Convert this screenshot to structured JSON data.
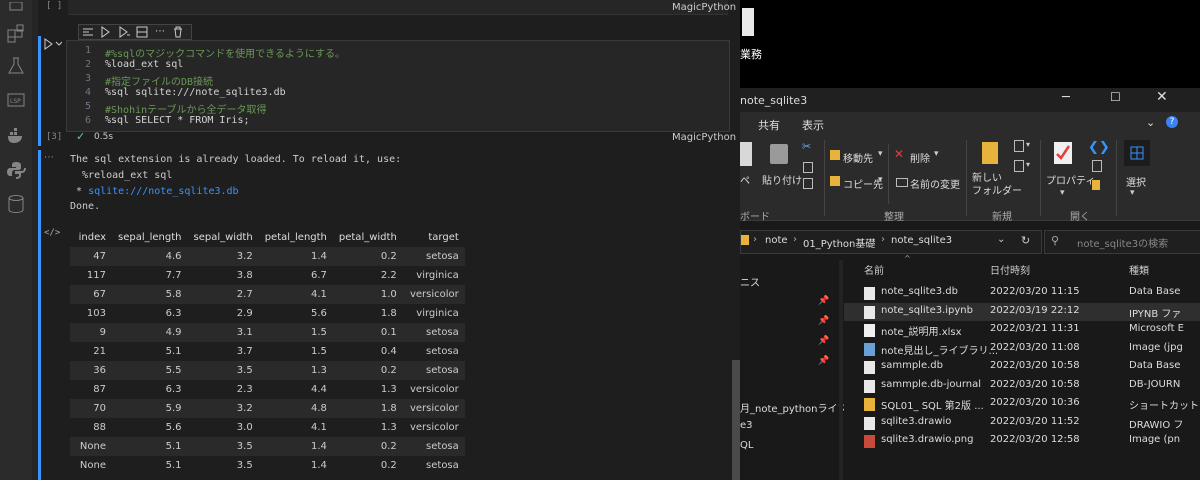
{
  "vscode": {
    "prev_cell_marker": "[ ]",
    "kernel": "MagicPython",
    "exec_count": "[3]",
    "exec_time": "0.5s",
    "code_lines": [
      {
        "n": "1",
        "text": "#%sqlのマジックコマンドを使用できるようにする。",
        "kind": "cmt"
      },
      {
        "n": "2",
        "text": "%load_ext sql",
        "kind": "txt"
      },
      {
        "n": "3",
        "text": "#指定ファイルのDB接続",
        "kind": "cmt"
      },
      {
        "n": "4",
        "text": "%sql sqlite:///note_sqlite3.db",
        "kind": "txt"
      },
      {
        "n": "5",
        "text": "#Shohinテーブルから全データ取得",
        "kind": "cmt"
      },
      {
        "n": "6",
        "text": "%sql SELECT * FROM Iris;",
        "kind": "txt"
      }
    ],
    "output_lines": [
      "The sql extension is already loaded. To reload it, use:",
      "  %reload_ext sql",
      " * sqlite:///note_sqlite3.db",
      "Done."
    ],
    "output_link": "sqlite:///note_sqlite3.db",
    "table": {
      "headers": [
        "index",
        "sepal_length",
        "sepal_width",
        "petal_length",
        "petal_width",
        "target"
      ],
      "rows": [
        [
          "47",
          "4.6",
          "3.2",
          "1.4",
          "0.2",
          "setosa"
        ],
        [
          "117",
          "7.7",
          "3.8",
          "6.7",
          "2.2",
          "virginica"
        ],
        [
          "67",
          "5.8",
          "2.7",
          "4.1",
          "1.0",
          "versicolor"
        ],
        [
          "103",
          "6.3",
          "2.9",
          "5.6",
          "1.8",
          "virginica"
        ],
        [
          "9",
          "4.9",
          "3.1",
          "1.5",
          "0.1",
          "setosa"
        ],
        [
          "21",
          "5.1",
          "3.7",
          "1.5",
          "0.4",
          "setosa"
        ],
        [
          "36",
          "5.5",
          "3.5",
          "1.3",
          "0.2",
          "setosa"
        ],
        [
          "87",
          "6.3",
          "2.3",
          "4.4",
          "1.3",
          "versicolor"
        ],
        [
          "70",
          "5.9",
          "3.2",
          "4.8",
          "1.8",
          "versicolor"
        ],
        [
          "88",
          "5.6",
          "3.0",
          "4.1",
          "1.3",
          "versicolor"
        ],
        [
          "None",
          "5.1",
          "3.5",
          "1.4",
          "0.2",
          "setosa"
        ],
        [
          "None",
          "5.1",
          "3.5",
          "1.4",
          "0.2",
          "setosa"
        ]
      ]
    }
  },
  "desktop_label": "業務",
  "explorer": {
    "title": "note_sqlite3",
    "tabs": [
      "共有",
      "表示"
    ],
    "ribbon": {
      "paste": "ペースト",
      "paste_shortcut": "貼り付け",
      "move_to": "移動先",
      "delete": "削除",
      "copy_to": "コピー先",
      "rename": "名前の変更",
      "new_folder": "新しい\nフォルダー",
      "properties": "プロパティ",
      "select": "選択",
      "groups": [
        "ボード",
        "整理",
        "新規",
        "開く"
      ]
    },
    "breadcrumb": [
      "note",
      "01_Python基礎",
      "note_sqlite3"
    ],
    "search_placeholder": "note_sqlite3の検索",
    "columns": [
      "名前",
      "日付時刻",
      "種類"
    ],
    "nav_items": [
      "ニス",
      "月_note_pythonライブ",
      "e3",
      "QL"
    ],
    "files": [
      {
        "name": "note_sqlite3.db",
        "date": "2022/03/20 11:15",
        "type": "Data Base",
        "icon": "db"
      },
      {
        "name": "note_sqlite3.ipynb",
        "date": "2022/03/19 22:12",
        "type": "IPYNB ファ",
        "icon": "doc",
        "selected": true
      },
      {
        "name": "note_説明用.xlsx",
        "date": "2022/03/21 11:31",
        "type": "Microsoft E",
        "icon": "xlsx"
      },
      {
        "name": "note見出し_ライブラリ...",
        "date": "2022/03/20 11:08",
        "type": "Image (jpg",
        "icon": "img"
      },
      {
        "name": "sammple.db",
        "date": "2022/03/20 10:58",
        "type": "Data Base",
        "icon": "db"
      },
      {
        "name": "sammple.db-journal",
        "date": "2022/03/20 10:58",
        "type": "DB-JOURN",
        "icon": "doc"
      },
      {
        "name": "SQL01_ SQL 第2版 ...",
        "date": "2022/03/20 10:36",
        "type": "ショートカット",
        "icon": "shortcut"
      },
      {
        "name": "sqlite3.drawio",
        "date": "2022/03/20 11:52",
        "type": "DRAWIO フ",
        "icon": "doc"
      },
      {
        "name": "sqlite3.drawio.png",
        "date": "2022/03/20 12:58",
        "type": "Image (pn",
        "icon": "png"
      }
    ]
  }
}
